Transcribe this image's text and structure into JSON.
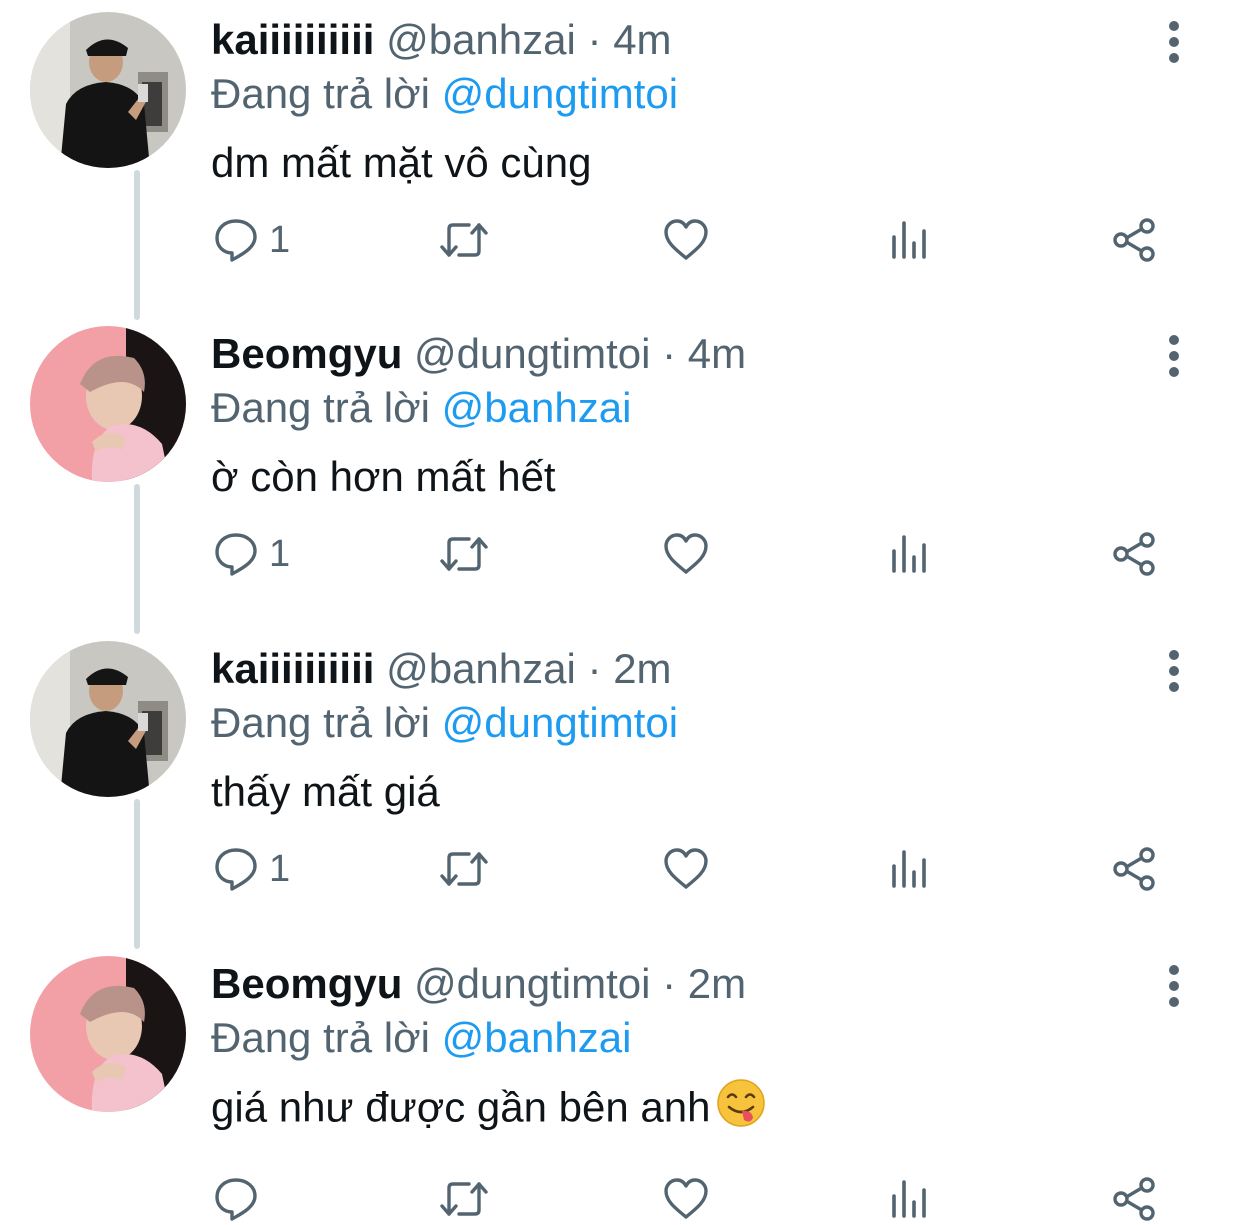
{
  "tweets": [
    {
      "name": "kaiiiiiiiiii",
      "handle": "@banhzai",
      "separator": "·",
      "time": "4m",
      "reply_prefix": "Đang trả lời",
      "reply_to": "@dungtimtoi",
      "text": "dm mất mặt vô cùng",
      "reply_count": "1",
      "avatar": "man-mirror-selfie"
    },
    {
      "name": "Beomgyu",
      "handle": "@dungtimtoi",
      "separator": "·",
      "time": "4m",
      "reply_prefix": "Đang trả lời",
      "reply_to": "@banhzai",
      "text": "ờ còn hơn mất hết",
      "reply_count": "1",
      "avatar": "pink-hoodie-boy"
    },
    {
      "name": "kaiiiiiiiiii",
      "handle": "@banhzai",
      "separator": "·",
      "time": "2m",
      "reply_prefix": "Đang trả lời",
      "reply_to": "@dungtimtoi",
      "text": "thấy mất giá",
      "reply_count": "1",
      "avatar": "man-mirror-selfie"
    },
    {
      "name": "Beomgyu",
      "handle": "@dungtimtoi",
      "separator": "·",
      "time": "2m",
      "reply_prefix": "Đang trả lời",
      "reply_to": "@banhzai",
      "text": "giá như được gần bên anh",
      "reply_count": "",
      "avatar": "pink-hoodie-boy",
      "emoji": "face-savoring-food-emoji"
    }
  ],
  "colors": {
    "text": "#0f1419",
    "muted": "#536471",
    "link": "#1d9bf0",
    "thread_line": "#cfd9de"
  }
}
